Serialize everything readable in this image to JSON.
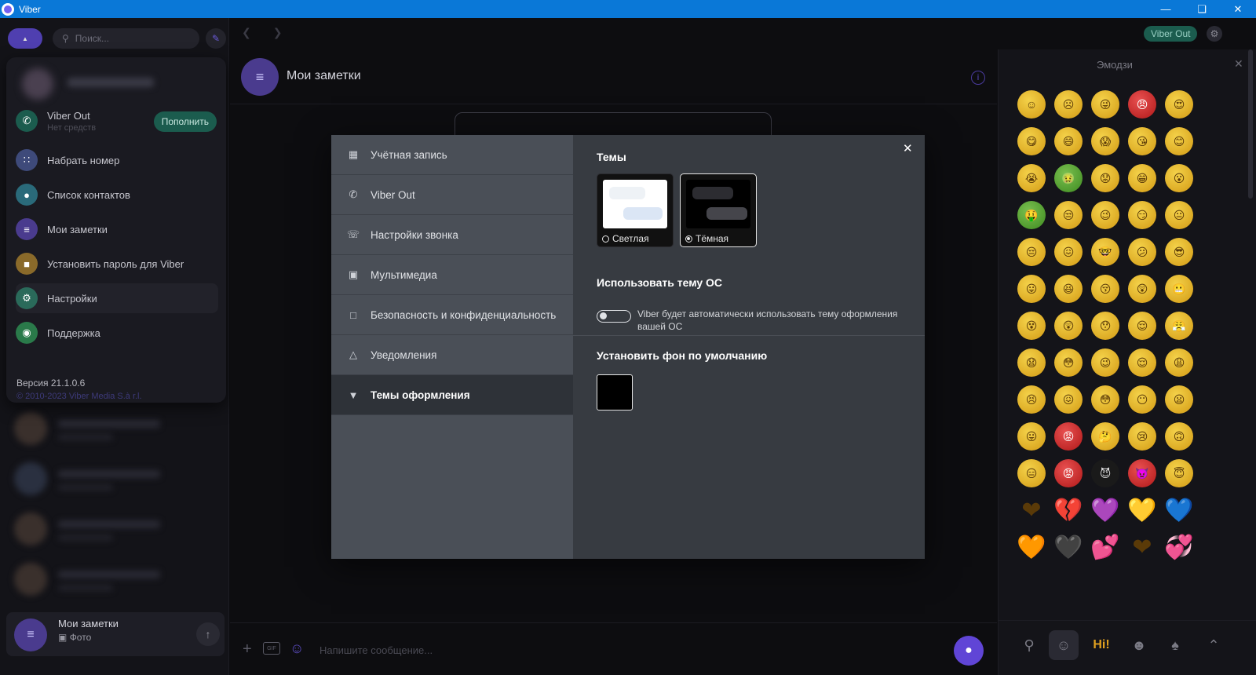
{
  "window": {
    "title": "Viber",
    "min_icon": "minimize-icon",
    "max_icon": "restore-icon",
    "close_icon": "close-icon"
  },
  "sidebar": {
    "search_placeholder": "Поиск...",
    "menu": {
      "viber_out": {
        "label": "Viber Out",
        "sub": "Нет средств",
        "topup_label": "Пополнить",
        "color": "#1b5c4e"
      },
      "items": [
        {
          "label": "Набрать номер",
          "icon": "dialpad-icon",
          "color": "#3e4a7a"
        },
        {
          "label": "Список контактов",
          "icon": "contacts-icon",
          "color": "#2a6a7a"
        },
        {
          "label": "Мои заметки",
          "icon": "notes-icon",
          "color": "#4a3b8e"
        },
        {
          "label": "Установить пароль для Viber",
          "icon": "lock-icon",
          "color": "#8a6a2a"
        },
        {
          "label": "Настройки",
          "icon": "gear-icon",
          "color": "#2a6a5a"
        },
        {
          "label": "Поддержка",
          "icon": "support-icon",
          "color": "#2a7a4a"
        }
      ],
      "version": "Версия 21.1.0.6",
      "copyright": "© 2010-2023 Viber Media S.à r.l."
    },
    "pinned_chat": {
      "title": "Мои заметки",
      "subtitle": "Фото"
    }
  },
  "chat": {
    "title": "Мои заметки",
    "composer_placeholder": "Напишите сообщение..."
  },
  "topbar": {
    "viber_out_label": "Viber Out"
  },
  "emoji_panel": {
    "title": "Эмодзи",
    "rows": [
      [
        "☺",
        "☹",
        "😜",
        "😠",
        "😍"
      ],
      [
        "😋",
        "😄",
        "😱",
        "😘",
        "😊"
      ],
      [
        "😭",
        "🤢",
        "😟",
        "😁",
        "😮"
      ],
      [
        "🤑",
        "😒",
        "😉",
        "😏",
        "😐"
      ],
      [
        "😔",
        "😖",
        "🤓",
        "😕",
        "😎"
      ],
      [
        "😛",
        "😆",
        "😚",
        "😲",
        "😬"
      ],
      [
        "😵",
        "😲",
        "😯",
        "😌",
        "😤"
      ],
      [
        "😧",
        "😳",
        "😉",
        "😌",
        "😩"
      ],
      [
        "😣",
        "😖",
        "😳",
        "😶",
        "😦"
      ],
      [
        "😛",
        "😡",
        "🤔",
        "😢",
        "🙃"
      ],
      [
        "😑",
        "😡",
        "😈",
        "👿",
        "😇"
      ],
      [
        "❤",
        "💔",
        "💜",
        "💛",
        "💙"
      ],
      [
        "🧡",
        "🖤",
        "💕",
        "❤",
        "💞"
      ]
    ]
  },
  "settings": {
    "nav": [
      {
        "label": "Учётная запись",
        "icon": "account-icon"
      },
      {
        "label": "Viber Out",
        "icon": "phone-out-icon"
      },
      {
        "label": "Настройки звонка",
        "icon": "call-settings-icon"
      },
      {
        "label": "Мультимедиа",
        "icon": "media-icon"
      },
      {
        "label": "Безопасность и конфиденциальность",
        "icon": "lock-icon"
      },
      {
        "label": "Уведомления",
        "icon": "bell-icon"
      },
      {
        "label": "Темы оформления",
        "icon": "brush-icon"
      }
    ],
    "themes_title": "Темы",
    "theme_light": "Светлая",
    "theme_dark": "Тёмная",
    "selected_theme": "dark",
    "os_theme_title": "Использовать тему ОС",
    "os_theme_desc": "Viber будет автоматически использовать тему оформления вашей ОС",
    "os_theme_enabled": false,
    "default_bg_title": "Установить фон по умолчанию"
  }
}
